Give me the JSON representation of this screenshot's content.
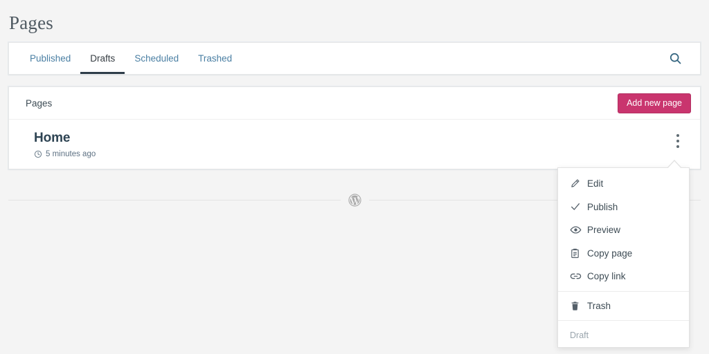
{
  "page": {
    "title": "Pages"
  },
  "tabs": [
    {
      "label": "Published",
      "active": false,
      "name": "tab-published"
    },
    {
      "label": "Drafts",
      "active": true,
      "name": "tab-drafts"
    },
    {
      "label": "Scheduled",
      "active": false,
      "name": "tab-scheduled"
    },
    {
      "label": "Trashed",
      "active": false,
      "name": "tab-trashed"
    }
  ],
  "toolbar": {
    "search_icon": "search-icon"
  },
  "pages_card": {
    "header_title": "Pages",
    "add_button_label": "Add new page",
    "rows": [
      {
        "title": "Home",
        "meta_icon": "clock-icon",
        "meta": "5 minutes ago",
        "menu_icon": "ellipsis-vertical-icon"
      }
    ]
  },
  "divider": {
    "icon": "wordpress-logo-icon"
  },
  "popover_menu": {
    "items": [
      {
        "label": "Edit",
        "icon": "pencil-icon"
      },
      {
        "label": "Publish",
        "icon": "checkmark-icon"
      },
      {
        "label": "Preview",
        "icon": "eye-icon"
      },
      {
        "label": "Copy page",
        "icon": "clipboard-icon"
      },
      {
        "label": "Copy link",
        "icon": "link-icon"
      },
      {
        "label": "Trash",
        "icon": "trash-icon"
      }
    ],
    "status_label": "Draft"
  },
  "colors": {
    "background": "#f4f4f4",
    "card": "#ffffff",
    "accent_pink": "#c9356e",
    "tab_link": "#4a7fa3",
    "tab_active": "#353c42",
    "text_primary": "#2e4453",
    "text_muted": "#9aa5ad"
  }
}
